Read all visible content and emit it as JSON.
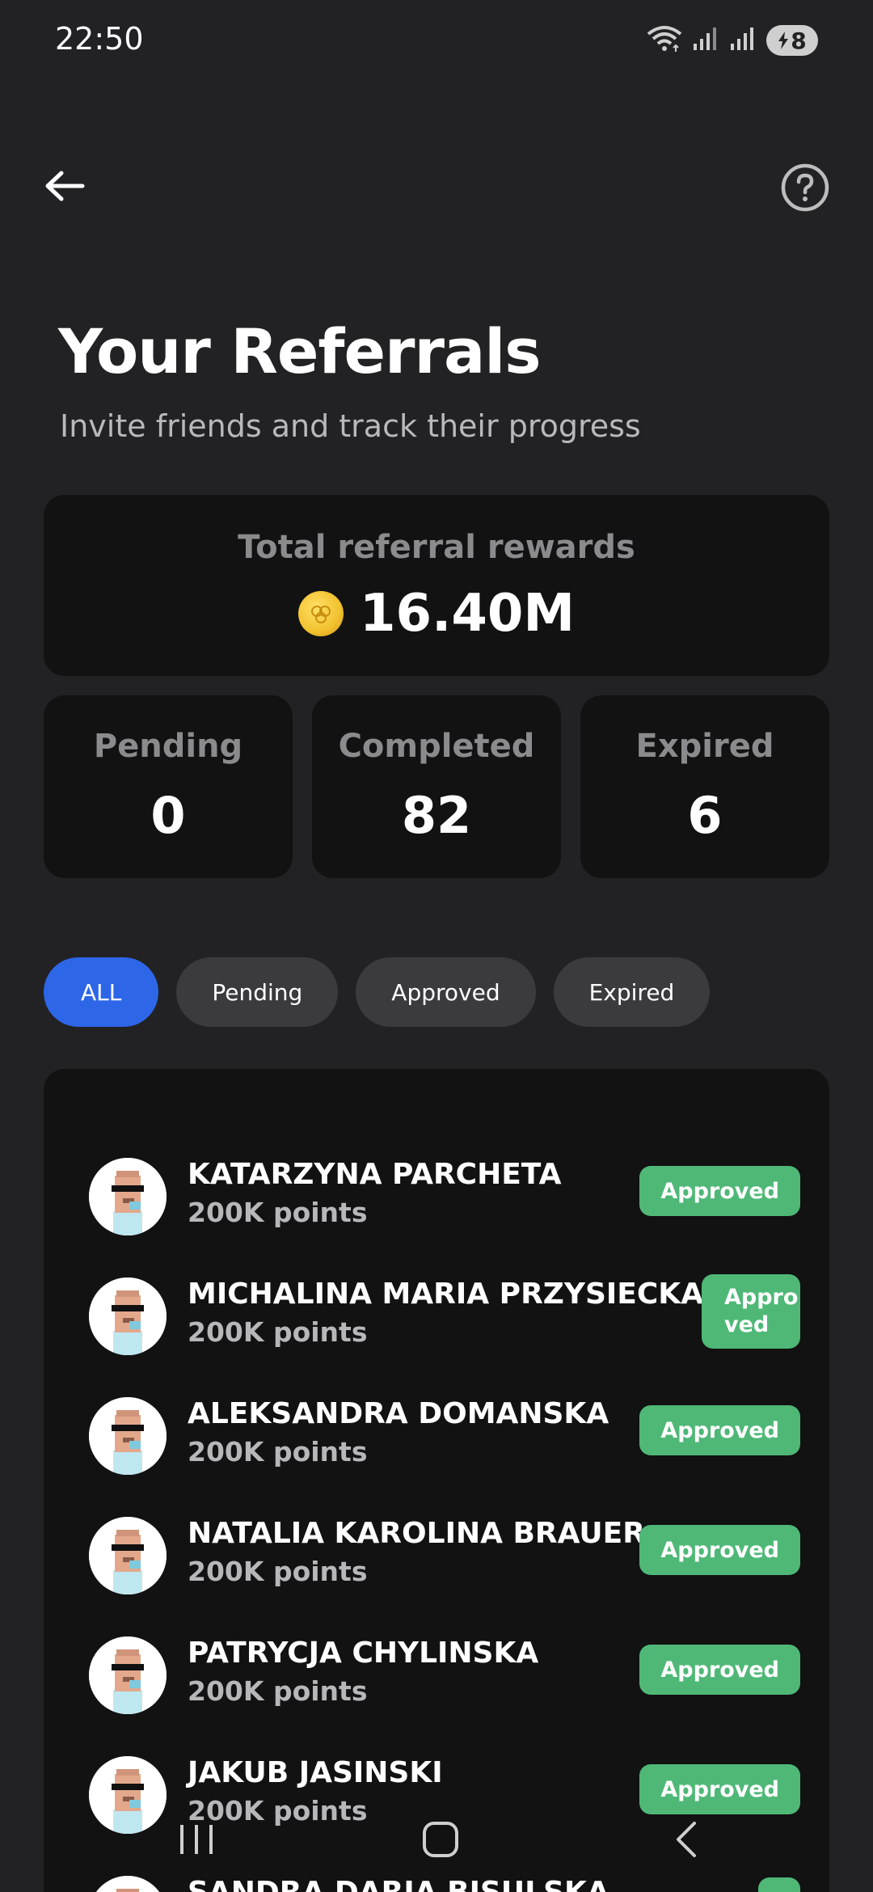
{
  "status_bar": {
    "time": "22:50",
    "battery_level": "8",
    "icons": [
      "wifi-icon",
      "signal-icon",
      "signal-icon",
      "battery-icon"
    ]
  },
  "nav": {
    "back_icon": "arrow-left-icon",
    "help_icon": "help-circle-icon"
  },
  "header": {
    "title": "Your Referrals",
    "subtitle": "Invite friends and track their progress"
  },
  "total_rewards": {
    "label": "Total referral rewards",
    "value": "16.40M",
    "icon": "coin-icon"
  },
  "stats": [
    {
      "label": "Pending",
      "value": "0"
    },
    {
      "label": "Completed",
      "value": "82"
    },
    {
      "label": "Expired",
      "value": "6"
    }
  ],
  "filters": [
    {
      "label": "ALL",
      "active": true
    },
    {
      "label": "Pending",
      "active": false
    },
    {
      "label": "Approved",
      "active": false
    },
    {
      "label": "Expired",
      "active": false
    }
  ],
  "referrals": [
    {
      "name": "KATARZYNA PARCHETA",
      "points": "200K points",
      "status": "Approved"
    },
    {
      "name": "MICHALINA MARIA PRZYSIECKA",
      "points": "200K points",
      "status": "Appro\nved"
    },
    {
      "name": "ALEKSANDRA DOMANSKA",
      "points": "200K points",
      "status": "Approved"
    },
    {
      "name": "NATALIA KAROLINA BRAUER",
      "points": "200K points",
      "status": "Approved"
    },
    {
      "name": "PATRYCJA CHYLINSKA",
      "points": "200K points",
      "status": "Approved"
    },
    {
      "name": "JAKUB JASINSKI",
      "points": "200K points",
      "status": "Approved"
    },
    {
      "name": "SANDRA DARIA BISULSKA",
      "points": "",
      "status": ""
    }
  ],
  "colors": {
    "background": "#222225",
    "card": "#121212",
    "accent": "#2e66e8",
    "approved": "#4fb877"
  },
  "system_nav": {
    "icons": [
      "recent-apps-icon",
      "home-icon",
      "back-icon"
    ]
  }
}
